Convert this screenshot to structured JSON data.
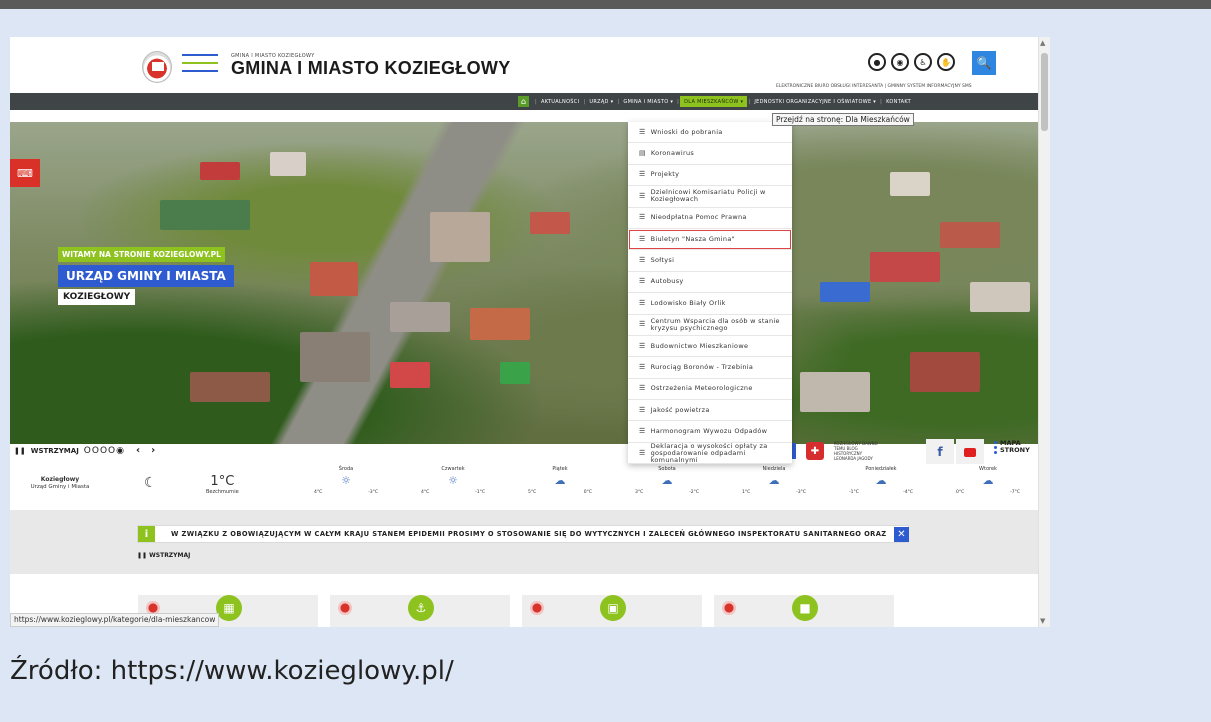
{
  "brand": {
    "subtitle": "GMINA I MIASTO KOZIEGŁOWY",
    "title": "GMINA I MIASTO KOZIEGŁOWY"
  },
  "header": {
    "ebok": "ELEKTRONICZNE BIURO OBSŁUGI INTERESANTA  |  GMINNY SYSTEM INFORMACYJNY SMS"
  },
  "nav": {
    "items": [
      "AKTUALNOŚCI",
      "URZĄD ▾",
      "GMINA I MIASTO ▾",
      "DLA MIESZKAŃCÓW ▾",
      "JEDNOSTKI ORGANIZACYJNE I OŚWIATOWE ▾",
      "KONTAKT"
    ],
    "tooltip": "Przejdź na stronę: Dla Mieszkańców"
  },
  "hero": {
    "welcome": "WITAMY NA STRONIE KOZIEGLOWY.PL",
    "title": "URZĄD GMINY I MIASTA",
    "subtitle": "KOZIEGŁOWY"
  },
  "dropdown": {
    "items": [
      "Wnioski do pobrania",
      "Koronawirus",
      "Projekty",
      "Dzielnicowi Komisariatu Policji w Koziegłowach",
      "Nieodpłatna Pomoc Prawna",
      "Biuletyn \"Nasza Gmina\"",
      "Sołtysi",
      "Autobusy",
      "Lodowisko Biały Orlik",
      "Centrum Wsparcia dla osób w stanie kryzysu psychicznego",
      "Budownictwo Mieszkaniowe",
      "Rurociąg Boronów - Trzebinia",
      "Ostrzeżenia Meteorologiczne",
      "Jakość powietrza",
      "Harmonogram Wywozu Odpadów",
      "Deklaracja o wysokości opłaty za gospodarowanie odpadami komunalnymi"
    ],
    "highlighted_index": 5
  },
  "slider": {
    "pause": "WSTRZYMAJ",
    "dots": "OOOO◉",
    "prev": "‹",
    "next": "›"
  },
  "partners": {
    "historic": "KOZIEGŁOWY DAWNO TEMU BLOG HISTORYCZNY LEONARDA JAGODY",
    "mapa": "MAPA STRONY"
  },
  "weather": {
    "city": "Koziegłowy",
    "city_sub": "Urząd Gminy i Miasta",
    "temp": "1°C",
    "condition": "Bezchmurnie",
    "days": [
      {
        "name": "Środa",
        "icon": "☼",
        "hi": "4°C",
        "lo": "-3°C"
      },
      {
        "name": "Czwartek",
        "icon": "☼",
        "hi": "4°C",
        "lo": "-1°C"
      },
      {
        "name": "Piątek",
        "icon": "☁",
        "hi": "5°C",
        "lo": "0°C"
      },
      {
        "name": "Sobota",
        "icon": "☁",
        "hi": "3°C",
        "lo": "-2°C"
      },
      {
        "name": "Niedziela",
        "icon": "☁",
        "hi": "1°C",
        "lo": "-3°C"
      },
      {
        "name": "Poniedziałek",
        "icon": "☁",
        "hi": "-1°C",
        "lo": "-4°C"
      },
      {
        "name": "Wtorek",
        "icon": "☁",
        "hi": "0°C",
        "lo": "-7°C"
      }
    ]
  },
  "notice": {
    "text": "W ZWIĄZKU Z OBOWIĄZUJĄCYM W CAŁYM KRAJU STANEM EPIDEMII PROSIMY O STOSOWANIE SIĘ DO WYTYCZNYCH I ZALECEŃ GŁÓWNEGO INSPEKTORATU SANITARNEGO ORAZ",
    "pause": "WSTRZYMAJ"
  },
  "status_url": "https://www.kozieglowy.pl/kategorie/dla-mieszkancow",
  "caption": "Źródło: https://www.kozieglowy.pl/",
  "colors": {
    "accent_green": "#8dc21f",
    "accent_blue": "#2f5bd0",
    "nav_bg": "#3f4547",
    "page_bg": "#dce6f4"
  }
}
